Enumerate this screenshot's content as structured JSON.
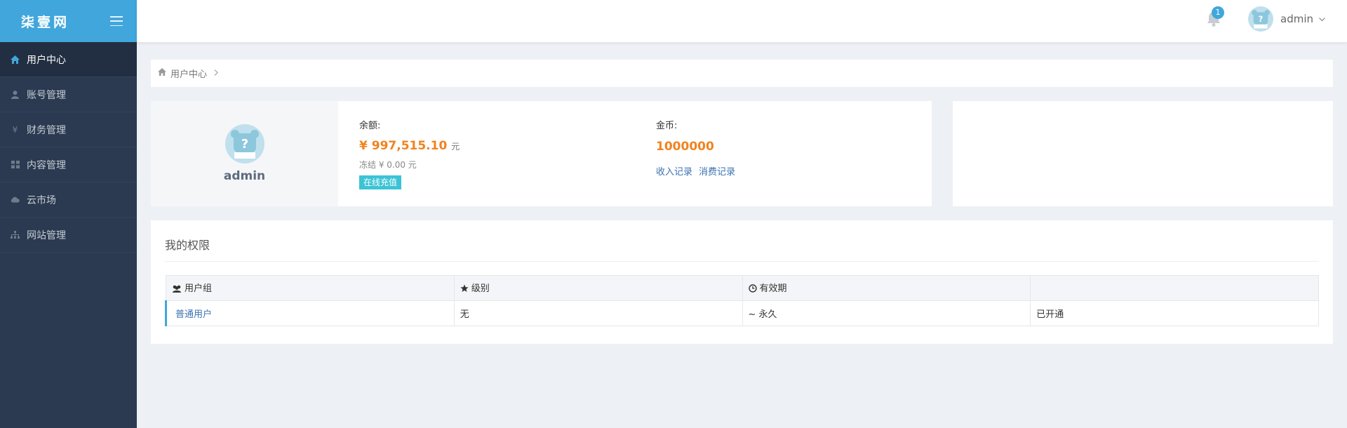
{
  "brand": {
    "logo_text": "柒壹网"
  },
  "sidebar": {
    "items": [
      {
        "label": "用户中心",
        "icon": "home-icon",
        "active": true
      },
      {
        "label": "账号管理",
        "icon": "user-icon",
        "active": false
      },
      {
        "label": "财务管理",
        "icon": "yen-icon",
        "active": false
      },
      {
        "label": "内容管理",
        "icon": "grid-icon",
        "active": false
      },
      {
        "label": "云市场",
        "icon": "cloud-icon",
        "active": false
      },
      {
        "label": "网站管理",
        "icon": "sitemap-icon",
        "active": false
      }
    ]
  },
  "topbar": {
    "notification_count": "1",
    "username": "admin"
  },
  "breadcrumb": {
    "current": "用户中心"
  },
  "profile": {
    "name": "admin",
    "balance_label": "余额:",
    "balance_value": "¥ 997,515.10",
    "balance_unit": "元",
    "frozen_text": "冻结 ¥ 0.00 元",
    "recharge_label": "在线充值",
    "coin_label": "金币:",
    "coin_value": "1000000",
    "income_link": "收入记录",
    "expense_link": "消费记录"
  },
  "permissions": {
    "title": "我的权限",
    "headers": [
      "用户组",
      "级别",
      "有效期",
      ""
    ],
    "rows": [
      [
        "普通用户",
        "无",
        "~ 永久",
        "已开通"
      ]
    ]
  },
  "colors": {
    "accent": "#40a6dc",
    "sidebar": "#2b3a50",
    "orange": "#f0831e",
    "recharge": "#3cc3d6",
    "link": "#3b72b0"
  }
}
